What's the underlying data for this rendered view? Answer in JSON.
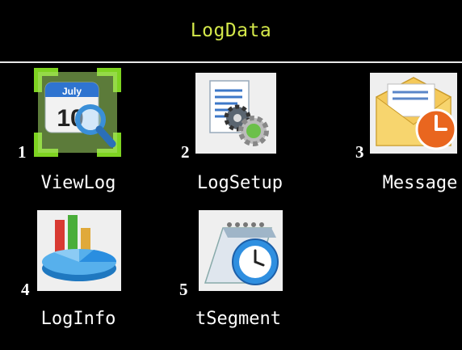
{
  "header": {
    "title": "LogData"
  },
  "menu": {
    "items": [
      {
        "number": "1",
        "label": "ViewLog",
        "icon": "calendar-search-icon",
        "selected": true
      },
      {
        "number": "2",
        "label": "LogSetup",
        "icon": "document-gear-icon",
        "selected": false
      },
      {
        "number": "3",
        "label": "Message",
        "icon": "envelope-clock-icon",
        "selected": false
      },
      {
        "number": "4",
        "label": "LogInfo",
        "icon": "pie-bar-chart-icon",
        "selected": false
      },
      {
        "number": "5",
        "label": "tSegment",
        "icon": "calendar-clock-icon",
        "selected": false
      }
    ],
    "calendar_icon": {
      "month": "July",
      "day": "10"
    }
  },
  "colors": {
    "background": "#000000",
    "title": "#d4e84a",
    "selection": "#7ed321",
    "text": "#ffffff"
  }
}
